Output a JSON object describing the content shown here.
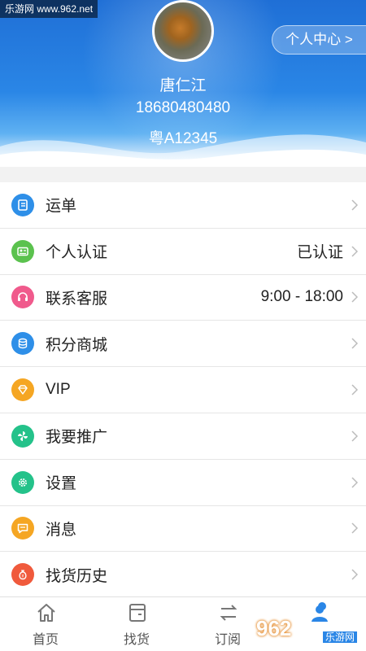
{
  "watermark_top": "乐游网 www.962.net",
  "header": {
    "center_button": "个人中心 >",
    "name": "唐仁江",
    "phone": "18680480480",
    "plate": "粤A12345"
  },
  "menu": [
    {
      "label": "运单",
      "value": "",
      "icon": "waybill-icon",
      "color": "#2e8fe8"
    },
    {
      "label": "个人认证",
      "value": "已认证",
      "icon": "id-card-icon",
      "color": "#5bc24e"
    },
    {
      "label": "联系客服",
      "value": "9:00 - 18:00",
      "icon": "headset-icon",
      "color": "#f05a8c"
    },
    {
      "label": "积分商城",
      "value": "",
      "icon": "coins-icon",
      "color": "#2e8fe8"
    },
    {
      "label": "VIP",
      "value": "",
      "icon": "diamond-icon",
      "color": "#f5a623"
    },
    {
      "label": "我要推广",
      "value": "",
      "icon": "pinwheel-icon",
      "color": "#24c28a"
    },
    {
      "label": "设置",
      "value": "",
      "icon": "gear-icon",
      "color": "#24c28a"
    },
    {
      "label": "消息",
      "value": "",
      "icon": "message-icon",
      "color": "#f5a623"
    },
    {
      "label": "找货历史",
      "value": "",
      "icon": "money-bag-icon",
      "color": "#f05a3c"
    }
  ],
  "tabs": [
    {
      "label": "首页",
      "icon": "home-icon"
    },
    {
      "label": "找货",
      "icon": "cargo-icon"
    },
    {
      "label": "订阅",
      "icon": "swap-icon"
    },
    {
      "label": "",
      "icon": "profile-icon"
    }
  ],
  "watermark_bottom": {
    "main": "962",
    "sub": "乐游网"
  }
}
